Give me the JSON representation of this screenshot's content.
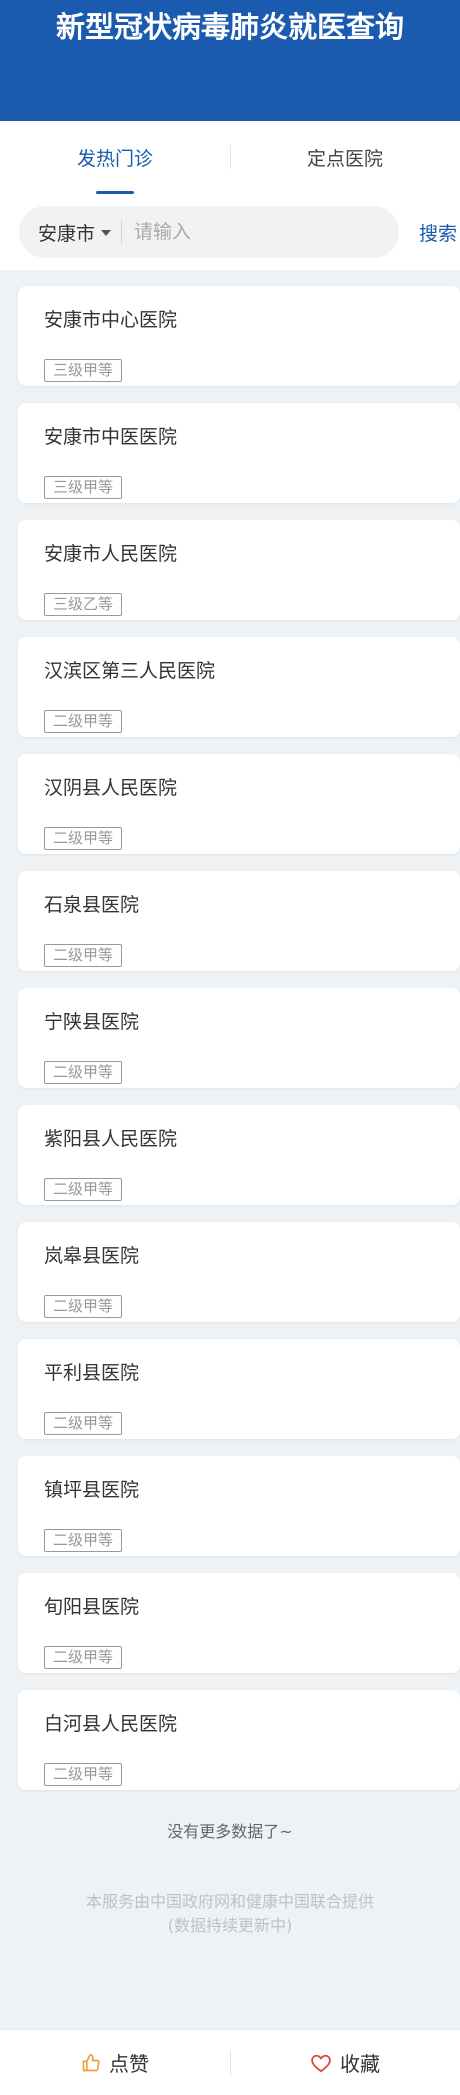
{
  "header": {
    "title": "新型冠状病毒肺炎就医查询"
  },
  "tabs": [
    {
      "label": "发热门诊",
      "active": true
    },
    {
      "label": "定点医院",
      "active": false
    }
  ],
  "search": {
    "city": "安康市",
    "placeholder": "请输入",
    "value": "",
    "button_label": "搜索"
  },
  "hospitals": [
    {
      "name": "安康市中心医院",
      "level": "三级甲等"
    },
    {
      "name": "安康市中医医院",
      "level": "三级甲等"
    },
    {
      "name": "安康市人民医院",
      "level": "三级乙等"
    },
    {
      "name": "汉滨区第三人民医院",
      "level": "二级甲等"
    },
    {
      "name": "汉阴县人民医院",
      "level": "二级甲等"
    },
    {
      "name": "石泉县医院",
      "level": "二级甲等"
    },
    {
      "name": "宁陕县医院",
      "level": "二级甲等"
    },
    {
      "name": "紫阳县人民医院",
      "level": "二级甲等"
    },
    {
      "name": "岚皋县医院",
      "level": "二级甲等"
    },
    {
      "name": "平利县医院",
      "level": "二级甲等"
    },
    {
      "name": "镇坪县医院",
      "level": "二级甲等"
    },
    {
      "name": "旬阳县医院",
      "level": "二级甲等"
    },
    {
      "name": "白河县人民医院",
      "level": "二级甲等"
    }
  ],
  "no_more": "没有更多数据了~",
  "footer_note": {
    "line1": "本服务由中国政府网和健康中国联合提供",
    "line2": "(数据持续更新中)"
  },
  "bottom_bar": {
    "like_label": "点赞",
    "like_icon": "thumbs-up-icon",
    "fav_label": "收藏",
    "fav_icon": "heart-icon"
  },
  "colors": {
    "brand": "#1a5bb0",
    "favorite": "#e0463c",
    "like": "#e8a33c"
  }
}
